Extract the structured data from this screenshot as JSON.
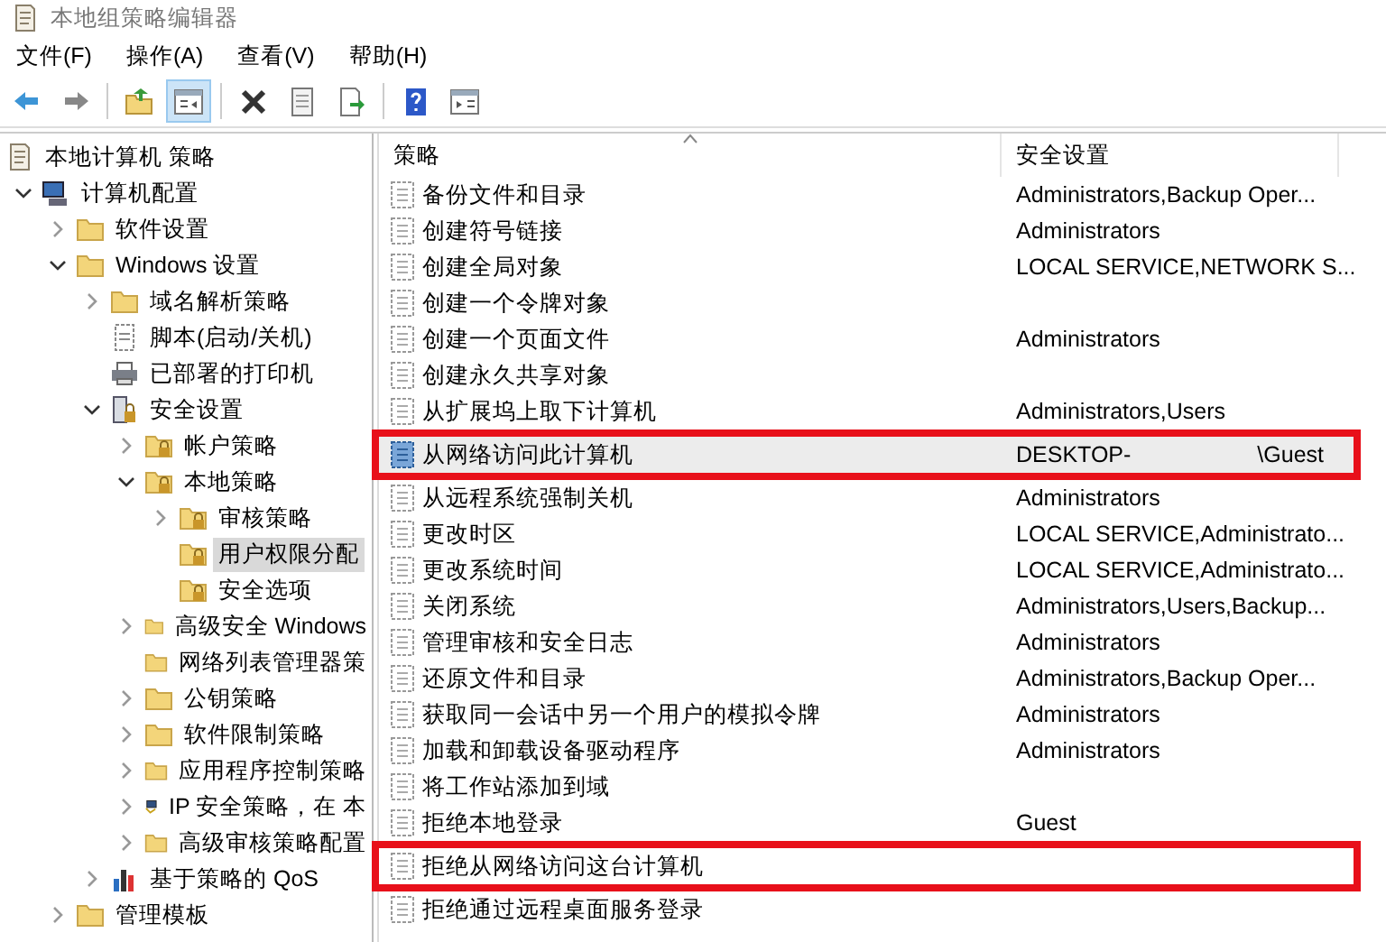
{
  "window": {
    "title": "本地组策略编辑器"
  },
  "menu": [
    "文件(F)",
    "操作(A)",
    "查看(V)",
    "帮助(H)"
  ],
  "toolbar": [
    {
      "kind": "back"
    },
    {
      "kind": "forward"
    },
    {
      "kind": "sep"
    },
    {
      "kind": "up"
    },
    {
      "kind": "tree",
      "pressed": true
    },
    {
      "kind": "sep"
    },
    {
      "kind": "delete"
    },
    {
      "kind": "properties"
    },
    {
      "kind": "export"
    },
    {
      "kind": "sep"
    },
    {
      "kind": "help"
    },
    {
      "kind": "panel"
    }
  ],
  "tree": [
    {
      "label": "本地计算机 策略",
      "kind": "doc",
      "selected": false,
      "children": [
        {
          "label": "计算机配置",
          "kind": "computer",
          "expanded": true,
          "selected": false,
          "children": [
            {
              "label": "软件设置",
              "kind": "folder",
              "expanded": false,
              "selected": false
            },
            {
              "label": "Windows 设置",
              "kind": "folder",
              "expanded": true,
              "selected": false,
              "children": [
                {
                  "label": "域名解析策略",
                  "kind": "folder",
                  "expanded": false,
                  "selected": false
                },
                {
                  "label": "脚本(启动/关机)",
                  "kind": "script",
                  "selected": false
                },
                {
                  "label": "已部署的打印机",
                  "kind": "printer",
                  "selected": false
                },
                {
                  "label": "安全设置",
                  "kind": "secure",
                  "expanded": true,
                  "selected": false,
                  "children": [
                    {
                      "label": "帐户策略",
                      "kind": "lockfolder",
                      "expanded": false,
                      "selected": false
                    },
                    {
                      "label": "本地策略",
                      "kind": "lockfolder",
                      "expanded": true,
                      "selected": false,
                      "children": [
                        {
                          "label": "审核策略",
                          "kind": "lockfolder",
                          "expanded": false,
                          "selected": false
                        },
                        {
                          "label": "用户权限分配",
                          "kind": "lockfolder",
                          "selected": true
                        },
                        {
                          "label": "安全选项",
                          "kind": "lockfolder",
                          "selected": false
                        }
                      ]
                    },
                    {
                      "label": "高级安全 Windows",
                      "kind": "folder",
                      "expanded": false,
                      "selected": false
                    },
                    {
                      "label": "网络列表管理器策",
                      "kind": "folder",
                      "selected": false
                    },
                    {
                      "label": "公钥策略",
                      "kind": "folder",
                      "expanded": false,
                      "selected": false
                    },
                    {
                      "label": "软件限制策略",
                      "kind": "folder",
                      "expanded": false,
                      "selected": false
                    },
                    {
                      "label": "应用程序控制策略",
                      "kind": "folder",
                      "expanded": false,
                      "selected": false
                    },
                    {
                      "label": "IP 安全策略，在 本",
                      "kind": "network",
                      "expanded": false,
                      "selected": false
                    },
                    {
                      "label": "高级审核策略配置",
                      "kind": "folder",
                      "expanded": false,
                      "selected": false
                    }
                  ]
                },
                {
                  "label": "基于策略的 QoS",
                  "kind": "chart",
                  "expanded": false,
                  "selected": false
                }
              ]
            },
            {
              "label": "管理模板",
              "kind": "folder",
              "expanded": false,
              "selected": false
            }
          ]
        }
      ]
    }
  ],
  "table": {
    "columns": [
      "策略",
      "安全设置"
    ],
    "sort_ascending": true,
    "rows": [
      {
        "policy": "备份文件和目录",
        "setting": "Administrators,Backup Oper...",
        "selected": false,
        "annotated": false
      },
      {
        "policy": "创建符号链接",
        "setting": "Administrators",
        "selected": false,
        "annotated": false
      },
      {
        "policy": "创建全局对象",
        "setting": "LOCAL SERVICE,NETWORK S...",
        "selected": false,
        "annotated": false
      },
      {
        "policy": "创建一个令牌对象",
        "selected": false,
        "annotated": false
      },
      {
        "policy": "创建一个页面文件",
        "setting": "Administrators",
        "selected": false,
        "annotated": false
      },
      {
        "policy": "创建永久共享对象",
        "selected": false,
        "annotated": false
      },
      {
        "policy": "从扩展坞上取下计算机",
        "setting": "Administrators,Users",
        "selected": false,
        "annotated": false
      },
      {
        "policy": "从网络访问此计算机",
        "setting": "DESKTOP-",
        "setting_after_gap": "\\Guest",
        "selected": true,
        "annotated": true
      },
      {
        "policy": "从远程系统强制关机",
        "setting": "Administrators",
        "selected": false,
        "annotated": false
      },
      {
        "policy": "更改时区",
        "setting": "LOCAL SERVICE,Administrato...",
        "selected": false,
        "annotated": false
      },
      {
        "policy": "更改系统时间",
        "setting": "LOCAL SERVICE,Administrato...",
        "selected": false,
        "annotated": false
      },
      {
        "policy": "关闭系统",
        "setting": "Administrators,Users,Backup...",
        "selected": false,
        "annotated": false
      },
      {
        "policy": "管理审核和安全日志",
        "setting": "Administrators",
        "selected": false,
        "annotated": false
      },
      {
        "policy": "还原文件和目录",
        "setting": "Administrators,Backup Oper...",
        "selected": false,
        "annotated": false
      },
      {
        "policy": "获取同一会话中另一个用户的模拟令牌",
        "setting": "Administrators",
        "selected": false,
        "annotated": false
      },
      {
        "policy": "加载和卸载设备驱动程序",
        "setting": "Administrators",
        "selected": false,
        "annotated": false
      },
      {
        "policy": "将工作站添加到域",
        "selected": false,
        "annotated": false
      },
      {
        "policy": "拒绝本地登录",
        "setting": "Guest",
        "selected": false,
        "annotated": false
      },
      {
        "policy": "拒绝从网络访问这台计算机",
        "selected": false,
        "annotated": true
      },
      {
        "policy": "拒绝通过远程桌面服务登录",
        "selected": false,
        "annotated": false
      }
    ]
  }
}
